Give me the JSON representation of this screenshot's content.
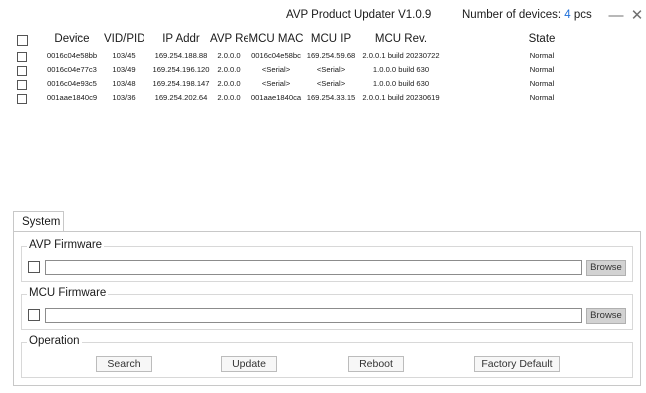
{
  "window": {
    "title": "AVP Product Updater V1.0.9",
    "device_count_label": "Number of devices:",
    "device_count": "4",
    "device_count_unit": "pcs",
    "minimize_glyph": "—",
    "close_glyph": "✕"
  },
  "table": {
    "columns": [
      "Device",
      "VID/PID",
      "IP Addr",
      "AVP Rev",
      "MCU MAC",
      "MCU IP",
      "MCU Rev.",
      "State"
    ],
    "rows": [
      [
        "0016c04e58bb",
        "103/45",
        "169.254.188.88",
        "2.0.0.0",
        "0016c04e58bc",
        "169.254.59.68",
        "2.0.0.1 build 20230722",
        "Normal"
      ],
      [
        "0016c04e77c3",
        "103/49",
        "169.254.196.120",
        "2.0.0.0",
        "<Serial>",
        "<Serial>",
        "1.0.0.0 build 630",
        "Normal"
      ],
      [
        "0016c04e93c5",
        "103/48",
        "169.254.198.147",
        "2.0.0.0",
        "<Serial>",
        "<Serial>",
        "1.0.0.0 build 630",
        "Normal"
      ],
      [
        "001aae1840c9",
        "103/36",
        "169.254.202.64",
        "2.0.0.0",
        "001aae1840ca",
        "169.254.33.15",
        "2.0.0.1 build 20230619",
        "Normal"
      ]
    ]
  },
  "tabs": [
    {
      "label": "System"
    }
  ],
  "avp_firmware": {
    "legend": "AVP Firmware",
    "path_value": "",
    "browse_label": "Browse"
  },
  "mcu_firmware": {
    "legend": "MCU Firmware",
    "path_value": "",
    "browse_label": "Browse"
  },
  "operation": {
    "legend": "Operation",
    "search_label": "Search",
    "update_label": "Update",
    "reboot_label": "Reboot",
    "factory_default_label": "Factory Default"
  },
  "colors": {
    "accent": "#1e6fd9",
    "browse_bg": "#d2d2d2"
  }
}
